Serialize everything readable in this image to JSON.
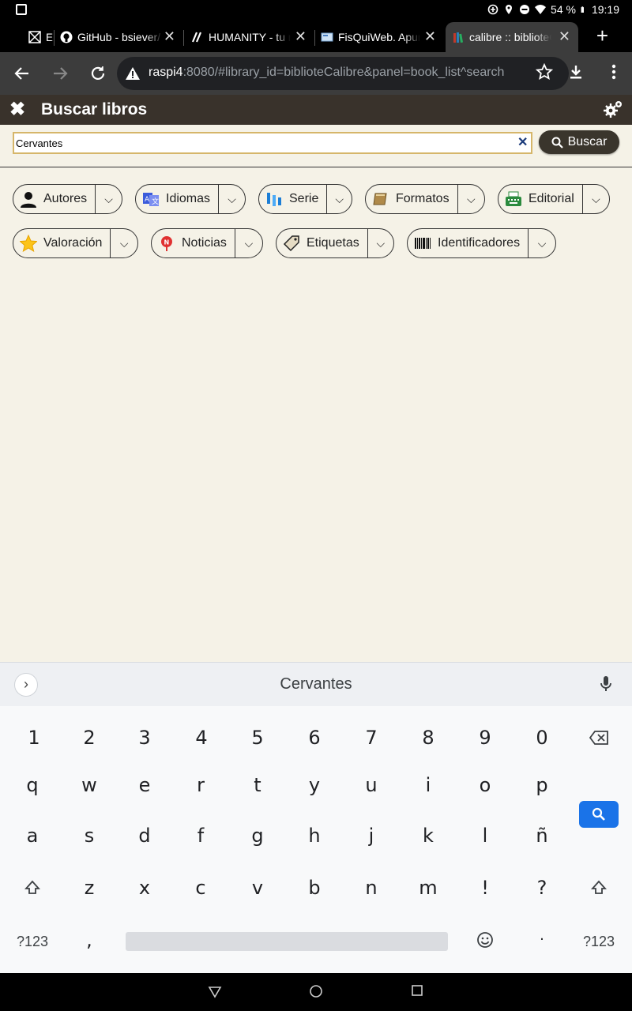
{
  "status_bar": {
    "battery": "54 %",
    "time": "19:19"
  },
  "tabs": [
    {
      "label": "E",
      "favicon": "grid-icon"
    },
    {
      "label": "GitHub - bsiever/",
      "favicon": "github-icon"
    },
    {
      "label": "HUMANITY - tu n",
      "favicon": "humanity-icon"
    },
    {
      "label": "FisQuiWeb. Apun",
      "favicon": "page-icon"
    },
    {
      "label": "calibre :: biblioteC",
      "favicon": "calibre-icon",
      "active": true
    }
  ],
  "toolbar": {
    "url_host": "raspi4",
    "url_rest": ":8080/#library_id=biblioteCalibre&panel=book_list^search"
  },
  "header": {
    "title": "Buscar libros"
  },
  "search": {
    "value": "Cervantes",
    "button_label": "Buscar"
  },
  "categories": [
    {
      "label": "Autores",
      "icon": "user-icon"
    },
    {
      "label": "Idiomas",
      "icon": "languages-icon"
    },
    {
      "label": "Serie",
      "icon": "series-icon"
    },
    {
      "label": "Formatos",
      "icon": "book-icon"
    },
    {
      "label": "Editorial",
      "icon": "typewriter-icon"
    },
    {
      "label": "Valoración",
      "icon": "star-icon"
    },
    {
      "label": "Noticias",
      "icon": "news-icon"
    },
    {
      "label": "Etiquetas",
      "icon": "tag-icon"
    },
    {
      "label": "Identificadores",
      "icon": "barcode-icon"
    }
  ],
  "keyboard": {
    "suggestion": "Cervantes",
    "row_numbers": [
      "1",
      "2",
      "3",
      "4",
      "5",
      "6",
      "7",
      "8",
      "9",
      "0"
    ],
    "row1": [
      "q",
      "w",
      "e",
      "r",
      "t",
      "y",
      "u",
      "i",
      "o",
      "p"
    ],
    "row2": [
      "a",
      "s",
      "d",
      "f",
      "g",
      "h",
      "j",
      "k",
      "l",
      "ñ"
    ],
    "row3": [
      "z",
      "x",
      "c",
      "v",
      "b",
      "n",
      "m",
      "!",
      "?"
    ],
    "symbols_label": "?123",
    "comma": ",",
    "period": "·"
  },
  "colors": {
    "header_bg": "#39322b",
    "page_bg": "#f5f2e7",
    "enter_key": "#1a73e8"
  }
}
